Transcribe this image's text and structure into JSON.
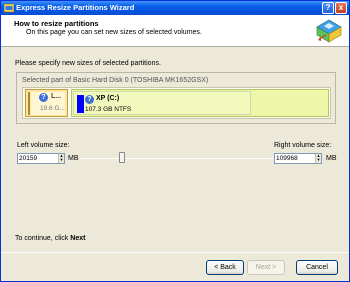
{
  "window": {
    "title": "Express Resize Partitions Wizard",
    "help_button": "?",
    "close_button": "x"
  },
  "header": {
    "title": "How to resize partitions",
    "subtitle": "On this page you can set new sizes of selected volumes."
  },
  "instruction": "Please specify new sizes of selected partitions.",
  "disk": {
    "group_title": "Selected part of Basic Hard Disk 0 (TOSHIBA MK1652GSX)",
    "left_partition": {
      "label": "L...",
      "size": "19.6 G..."
    },
    "main_partition": {
      "name": "XP (C:)",
      "detail": "107.3 GB NTFS"
    }
  },
  "left_volume": {
    "label": "Left volume size:",
    "value": "20159",
    "unit": "MB"
  },
  "right_volume": {
    "label": "Right volume size:",
    "value": "109968",
    "unit": "MB"
  },
  "slider": {
    "position_fraction": 0.21
  },
  "footer": {
    "hint_prefix": "To continue, click",
    "hint_action": "Next"
  },
  "buttons": {
    "back": "< Back",
    "next": "Next >",
    "cancel": "Cancel"
  }
}
